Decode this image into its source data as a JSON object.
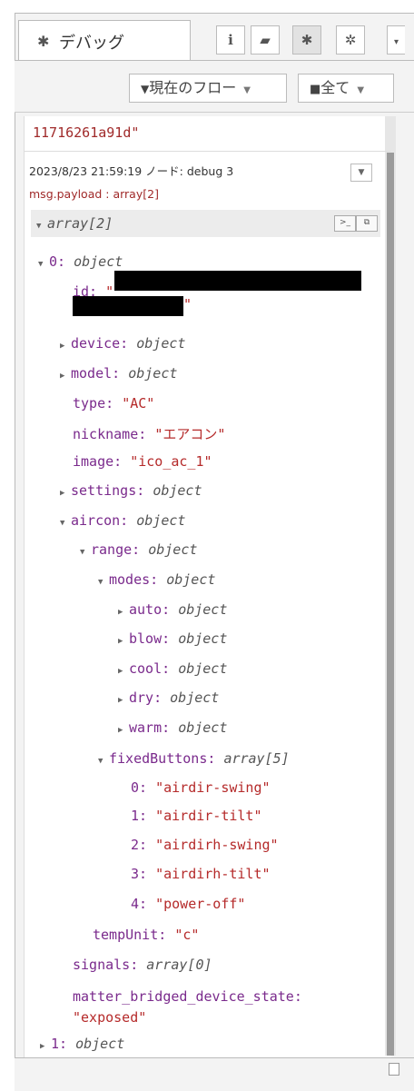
{
  "tab": {
    "label": "デバッグ"
  },
  "toolbar": {
    "filter_label": "現在のフロー",
    "clear_label": "全て"
  },
  "icons": {
    "info": "info-icon",
    "help": "book-icon",
    "debug": "bug-icon",
    "config": "gear-icon",
    "more": "chevron-down-icon"
  },
  "prev_message": {
    "text": "11716261a91d\""
  },
  "message": {
    "timestamp_node": "2023/8/23 21:59:19  ノード: debug 3",
    "topic": "msg.payload : array[2]",
    "root": "array[2]"
  },
  "tree": [
    {
      "key": "0",
      "tri": "▼",
      "type": "object"
    },
    {
      "key": "id",
      "val": "\"",
      "tail": "\""
    },
    {
      "key": "device",
      "tri": "▶",
      "type": "object"
    },
    {
      "key": "model",
      "tri": "▶",
      "type": "object"
    },
    {
      "key": "type",
      "val": "\"AC\""
    },
    {
      "key": "nickname",
      "val": "\"エアコン\""
    },
    {
      "key": "image",
      "val": "\"ico_ac_1\""
    },
    {
      "key": "settings",
      "tri": "▶",
      "type": "object"
    },
    {
      "key": "aircon",
      "tri": "▼",
      "type": "object"
    },
    {
      "key": "range",
      "tri": "▼",
      "type": "object"
    },
    {
      "key": "modes",
      "tri": "▼",
      "type": "object"
    },
    {
      "key": "auto",
      "tri": "▶",
      "type": "object"
    },
    {
      "key": "blow",
      "tri": "▶",
      "type": "object"
    },
    {
      "key": "cool",
      "tri": "▶",
      "type": "object"
    },
    {
      "key": "dry",
      "tri": "▶",
      "type": "object"
    },
    {
      "key": "warm",
      "tri": "▶",
      "type": "object"
    },
    {
      "key": "fixedButtons",
      "tri": "▼",
      "type": "array[5]"
    },
    {
      "key": "0",
      "val": "\"airdir-swing\""
    },
    {
      "key": "1",
      "val": "\"airdir-tilt\""
    },
    {
      "key": "2",
      "val": "\"airdirh-swing\""
    },
    {
      "key": "3",
      "val": "\"airdirh-tilt\""
    },
    {
      "key": "4",
      "val": "\"power-off\""
    },
    {
      "key": "tempUnit",
      "val": "\"c\""
    },
    {
      "key": "signals",
      "type": "array[0]"
    },
    {
      "key": "matter_bridged_device_state",
      "val": "\"exposed\""
    },
    {
      "key": "1",
      "tri": "▶",
      "type": "object"
    }
  ]
}
